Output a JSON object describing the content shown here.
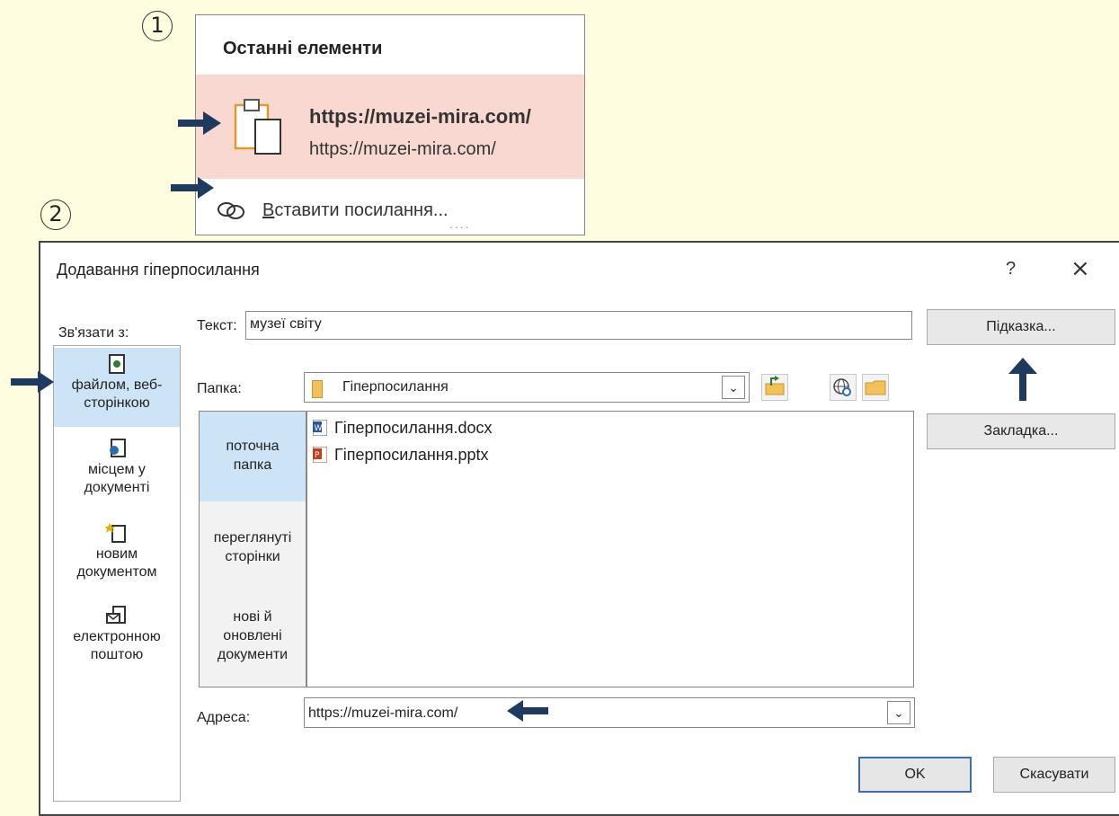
{
  "step_badges": [
    "1",
    "2"
  ],
  "recent_panel": {
    "title": "Останні елементи",
    "item_title": "https://muzei-mira.com/",
    "item_subtitle": "https://muzei-mira.com/",
    "insert_link_prefix": "В",
    "insert_link_rest": "ставити посилання...",
    "more": "...."
  },
  "dialog": {
    "title": "Додавання гіперпосилання",
    "help": "?",
    "close": "×",
    "link_to_label": "Зв'язати з:",
    "nav": [
      {
        "icon": "web-page-icon",
        "line1": "файлом, веб-",
        "line2": "сторінкою",
        "selected": true
      },
      {
        "icon": "document-place-icon",
        "line1": "місцем у",
        "line2": "документі",
        "selected": false
      },
      {
        "icon": "new-document-icon",
        "line1": "новим",
        "line2": "документом",
        "selected": false
      },
      {
        "icon": "email-icon",
        "line1": "електронною",
        "line2": "поштою",
        "selected": false
      }
    ],
    "text_label": "Текст:",
    "text_value": "музеї світу",
    "screentip_button": "Підказка...",
    "folder_label": "Папка:",
    "folder_value": "Гіперпосилання",
    "browse": [
      {
        "line1": "поточна",
        "line2": "папка",
        "line3": "",
        "selected": true
      },
      {
        "line1": "переглянуті",
        "line2": "сторінки",
        "line3": "",
        "selected": false
      },
      {
        "line1": "нові й",
        "line2": "оновлені",
        "line3": "документи",
        "selected": false
      }
    ],
    "files": [
      {
        "name": "Гіперпосилання.docx",
        "type": "word"
      },
      {
        "name": "Гіперпосилання.pptx",
        "type": "powerpoint"
      }
    ],
    "bookmark_button": "Закладка...",
    "address_label": "Адреса:",
    "address_value": "https://muzei-mira.com/",
    "ok_button": "OK",
    "cancel_button": "Скасувати"
  },
  "colors": {
    "background": "#fffde0",
    "highlight_recent": "#f9d8d2",
    "selected_nav": "#cde3f6",
    "arrow": "#1f3a5f"
  }
}
